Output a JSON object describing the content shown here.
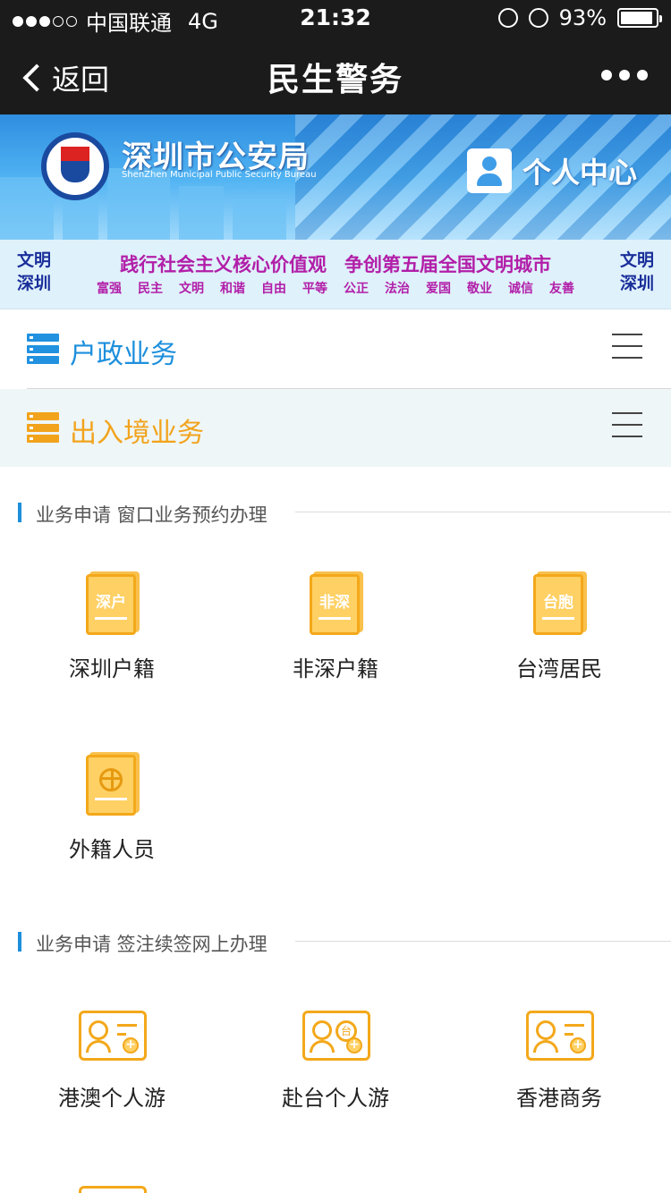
{
  "status_bar": {
    "carrier": "中国联通",
    "network": "4G",
    "time": "21:32",
    "battery": "93%",
    "battery_level": 0.93
  },
  "nav": {
    "back_label": "返回",
    "title": "民生警务"
  },
  "banner": {
    "bureau_name": "深圳市公安局",
    "bureau_name_en": "ShenZhen Municipal Public Security Bureau",
    "personal_center": "个人中心"
  },
  "slogan": {
    "badge_line1": "文明",
    "badge_line2": "深圳",
    "main_left": "践行社会主义核心价值观",
    "main_right": "争创第五届全国文明城市",
    "values": [
      "富强",
      "民主",
      "文明",
      "和谐",
      "自由",
      "平等",
      "公正",
      "法治",
      "爱国",
      "敬业",
      "诚信",
      "友善"
    ]
  },
  "categories": [
    {
      "label": "户政业务",
      "color": "#1d8fdc"
    },
    {
      "label": "出入境业务",
      "color": "#f2a31c"
    }
  ],
  "sections": [
    {
      "title": "业务申请 窗口业务预约办理",
      "items": [
        {
          "label": "深圳户籍",
          "icon_text": "深户",
          "icon": "passport-book-icon"
        },
        {
          "label": "非深户籍",
          "icon_text": "非深",
          "icon": "passport-book-icon"
        },
        {
          "label": "台湾居民",
          "icon_text": "台胞",
          "icon": "passport-book-icon"
        },
        {
          "label": "外籍人员",
          "icon_text": "",
          "icon": "globe-passport-icon"
        }
      ]
    },
    {
      "title": "业务申请 签注续签网上办理",
      "items": [
        {
          "label": "港澳个人游",
          "icon_text": "",
          "icon": "id-card-plus-icon"
        },
        {
          "label": "赴台个人游",
          "icon_text": "台",
          "icon": "id-card-taiwan-icon"
        },
        {
          "label": "香港商务",
          "icon_text": "",
          "icon": "business-card-plus-icon"
        }
      ]
    }
  ],
  "colors": {
    "header_bg": "#1b1b1b",
    "accent_blue": "#1d8fdc",
    "accent_orange": "#f2a31c",
    "slogan_purple": "#b21ea8"
  }
}
